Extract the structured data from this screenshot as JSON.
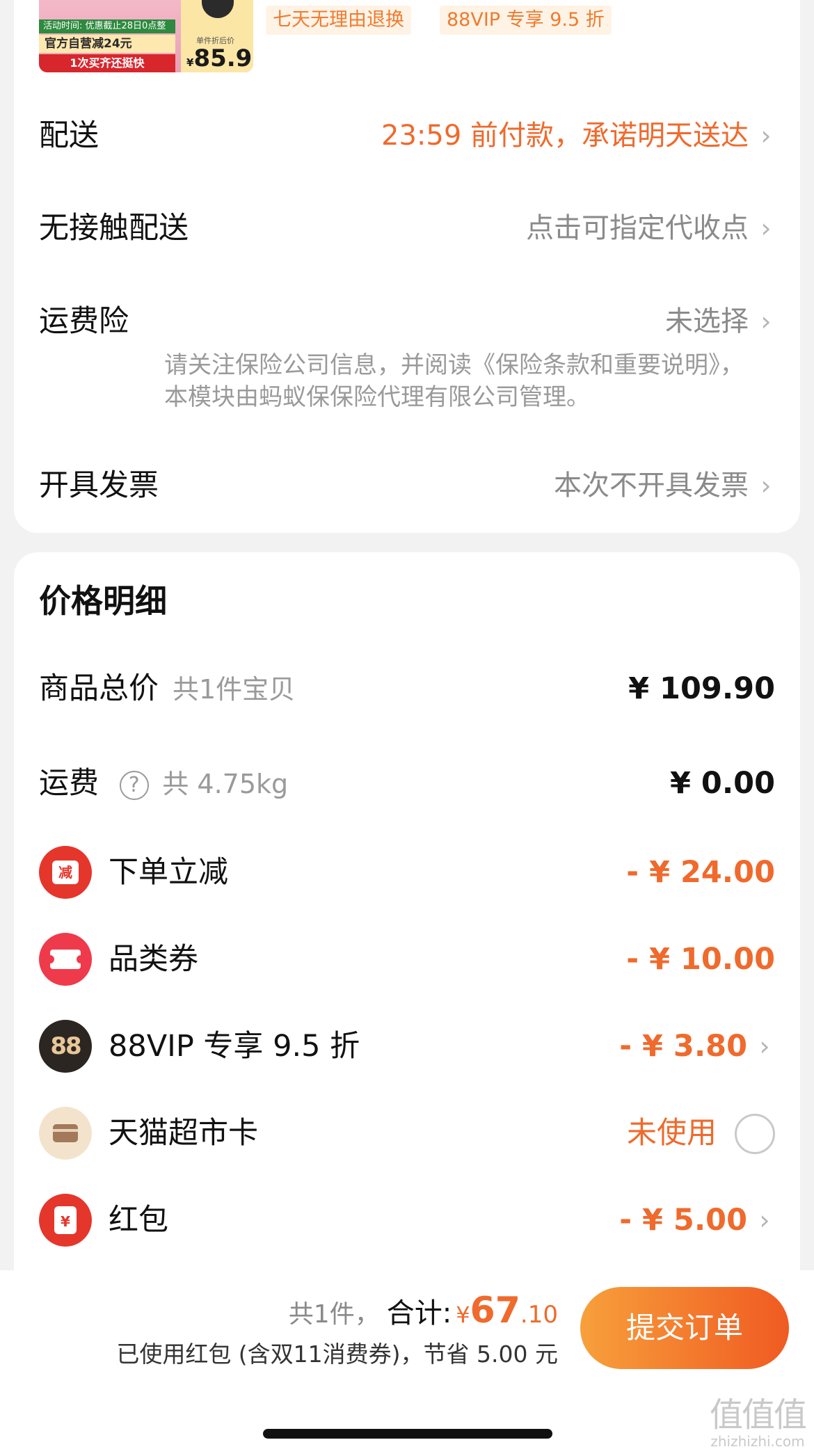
{
  "product": {
    "thumb_promo_line": "活动时间: 优惠截止28日0点整",
    "thumb_discount": "官方自营减24元",
    "thumb_cta": "1次买齐还挺快",
    "thumb_unit_label": "单件折后价",
    "thumb_currency": "¥",
    "thumb_price": "85.9",
    "tags": [
      "七天无理由退换",
      "88VIP 专享 9.5 折"
    ]
  },
  "shipping": {
    "delivery_label": "配送",
    "delivery_value": "23:59 前付款，承诺明天送达",
    "contactless_label": "无接触配送",
    "contactless_value": "点击可指定代收点",
    "insurance_label": "运费险",
    "insurance_value": "未选择",
    "insurance_note": "请关注保险公司信息，并阅读《保险条款和重要说明》，本模块由蚂蚁保保险代理有限公司管理。",
    "invoice_label": "开具发票",
    "invoice_value": "本次不开具发票"
  },
  "price_detail": {
    "title": "价格明细",
    "goods_total_label": "商品总价",
    "goods_total_sub": "共1件宝贝",
    "goods_total_value": "¥ 109.90",
    "freight_label": "运费",
    "freight_sub": "共 4.75kg",
    "freight_value": "¥ 0.00",
    "instant_discount_icon_text": "减",
    "instant_discount_label": "下单立减",
    "instant_discount_value": "- ¥ 24.00",
    "category_coupon_label": "品类券",
    "category_coupon_value": "- ¥ 10.00",
    "vip_icon_text": "88",
    "vip_label": "88VIP 专享 9.5 折",
    "vip_value": "- ¥ 3.80",
    "tmall_card_label": "天猫超市卡",
    "tmall_card_value": "未使用",
    "red_packet_icon_text": "¥",
    "red_packet_label": "红包",
    "red_packet_value": "- ¥ 5.00"
  },
  "footer": {
    "count": "共1件，",
    "total_label": "合计:",
    "currency": "¥",
    "total_int": "67",
    "total_dec": ".10",
    "saved_text": "已使用红包 (含双11消费券)，节省 5.00 元",
    "submit_label": "提交订单",
    "watermark_logo": "值值值",
    "watermark_url": "zhizhizhi.com"
  },
  "colors": {
    "accent_orange": "#ef6a2c",
    "submit_gradient_start": "#f7a03b",
    "submit_gradient_end": "#f05a22"
  }
}
